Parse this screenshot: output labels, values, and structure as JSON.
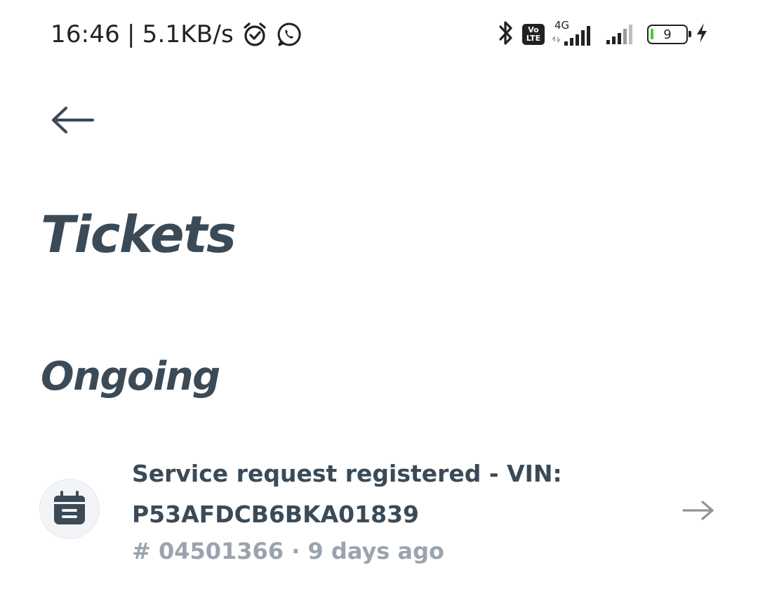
{
  "status_bar": {
    "time": "16:46",
    "separator": "|",
    "net_speed": "5.1KB/s",
    "volte_top": "Vo",
    "volte_bottom": "LTE",
    "network_type": "4G",
    "battery_level": "9",
    "battery_fill_color": "#4cc83a",
    "icons": [
      "alarm-icon",
      "whatsapp-icon",
      "bluetooth-icon",
      "volte-icon",
      "signal-icon",
      "signal-icon",
      "battery-icon",
      "charging-icon"
    ]
  },
  "header": {
    "back_icon": "arrow-left-icon",
    "title": "Tickets"
  },
  "sections": [
    {
      "title": "Ongoing",
      "tickets": [
        {
          "icon": "calendar-icon",
          "title_line1": "Service request registered - VIN:",
          "title_line2": "P53AFDCB6BKA01839",
          "ticket_number": "# 04501366",
          "meta_separator": "·",
          "age": "9 days ago",
          "action_icon": "arrow-right-icon"
        }
      ]
    }
  ],
  "colors": {
    "primary_text": "#3b4a57",
    "secondary_text": "#9aa4ae",
    "avatar_bg": "#f2f4f7",
    "background": "#ffffff"
  }
}
